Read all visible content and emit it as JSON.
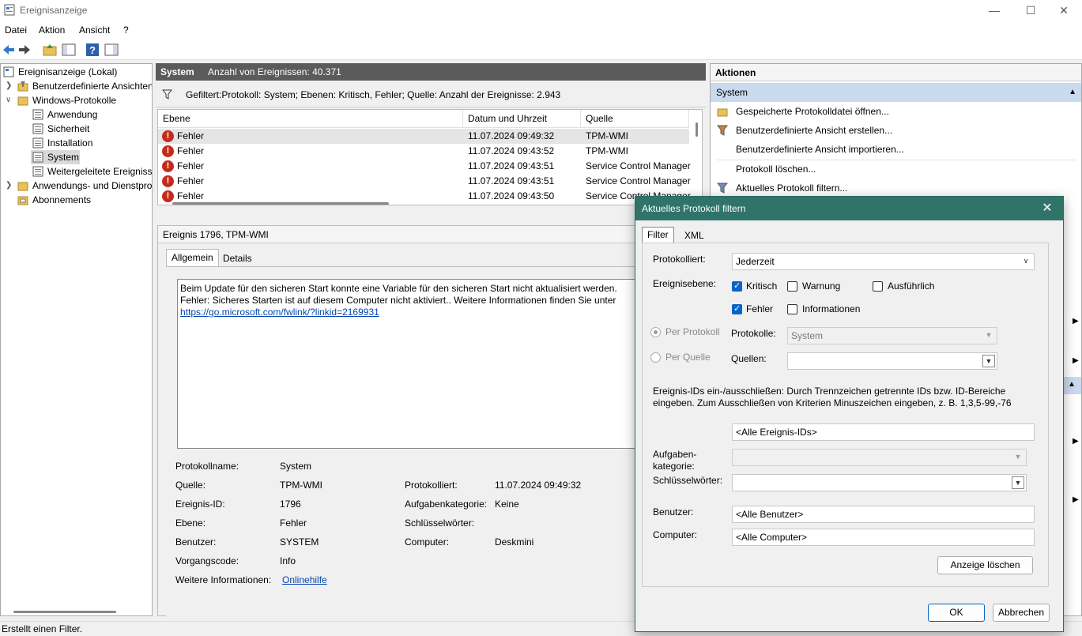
{
  "window": {
    "title": "Ereignisanzeige",
    "minimize": "—",
    "maximize": "☐",
    "close": "✕"
  },
  "menu": [
    "Datei",
    "Aktion",
    "Ansicht",
    "?"
  ],
  "tree": {
    "root": "Ereignisanzeige (Lokal)",
    "custom_views": "Benutzerdefinierte Ansichten",
    "windows_logs": "Windows-Protokolle",
    "logs": [
      "Anwendung",
      "Sicherheit",
      "Installation",
      "System",
      "Weitergeleitete Ereignisse"
    ],
    "app_service_logs": "Anwendungs- und Dienstprotokolle",
    "subscriptions": "Abonnements"
  },
  "center": {
    "header_title": "System",
    "header_count": "Anzahl von Ereignissen: 40.371",
    "filter_text": "Gefiltert:Protokoll: System; Ebenen: Kritisch, Fehler; Quelle:  Anzahl der Ereignisse: 2.943",
    "columns": [
      "Ebene",
      "Datum und Uhrzeit",
      "Quelle"
    ],
    "rows": [
      {
        "level": "Fehler",
        "date": "11.07.2024 09:49:32",
        "source": "TPM-WMI"
      },
      {
        "level": "Fehler",
        "date": "11.07.2024 09:43:52",
        "source": "TPM-WMI"
      },
      {
        "level": "Fehler",
        "date": "11.07.2024 09:43:51",
        "source": "Service Control Manager"
      },
      {
        "level": "Fehler",
        "date": "11.07.2024 09:43:51",
        "source": "Service Control Manager"
      },
      {
        "level": "Fehler",
        "date": "11.07.2024 09:43:50",
        "source": "Service Control Manager"
      }
    ]
  },
  "detail": {
    "title": "Ereignis 1796, TPM-WMI",
    "tabs": [
      "Allgemein",
      "Details"
    ],
    "description": "Beim Update für den sicheren Start konnte eine Variable für den sicheren Start nicht aktualisiert werden. Fehler: Sicheres Starten ist auf diesem Computer nicht aktiviert.. Weitere Informationen finden Sie unter",
    "link": "https://go.microsoft.com/fwlink/?linkid=2169931",
    "props": {
      "logname_label": "Protokollname:",
      "logname": "System",
      "source_label": "Quelle:",
      "source": "TPM-WMI",
      "logged_label": "Protokolliert:",
      "logged": "11.07.2024 09:49:32",
      "eventid_label": "Ereignis-ID:",
      "eventid": "1796",
      "taskcat_label": "Aufgabenkategorie:",
      "taskcat": "Keine",
      "level_label": "Ebene:",
      "level": "Fehler",
      "keywords_label": "Schlüsselwörter:",
      "user_label": "Benutzer:",
      "user": "SYSTEM",
      "computer_label": "Computer:",
      "computer": "Deskmini",
      "opcode_label": "Vorgangscode:",
      "opcode": "Info",
      "moreinfo_label": "Weitere Informationen:",
      "moreinfo": "Onlinehilfe"
    }
  },
  "actions": {
    "title": "Aktionen",
    "section": "System",
    "items": [
      "Gespeicherte Protokolldatei öffnen...",
      "Benutzerdefinierte Ansicht erstellen...",
      "Benutzerdefinierte Ansicht importieren...",
      "Protokoll löschen...",
      "Aktuelles Protokoll filtern..."
    ]
  },
  "dialog": {
    "title": "Aktuelles Protokoll filtern",
    "tabs": [
      "Filter",
      "XML"
    ],
    "logged_label": "Protokolliert:",
    "logged_value": "Jederzeit",
    "level_label": "Ereignisebene:",
    "levels": {
      "critical": "Kritisch",
      "warning": "Warnung",
      "verbose": "Ausführlich",
      "error": "Fehler",
      "info": "Informationen"
    },
    "by_log": "Per Protokoll",
    "by_source": "Per Quelle",
    "logs_label": "Protokolle:",
    "logs_value": "System",
    "sources_label": "Quellen:",
    "ids_hint": "Ereignis-IDs ein-/ausschließen: Durch Trennzeichen getrennte IDs bzw. ID-Bereiche eingeben. Zum Ausschließen von Kriterien Minuszeichen eingeben, z. B. 1,3,5-99,-76",
    "ids_value": "<Alle Ereignis-IDs>",
    "taskcat_label_1": "Aufgaben-",
    "taskcat_label_2": "kategorie:",
    "keywords_label": "Schlüsselwörter:",
    "user_label": "Benutzer:",
    "user_value": "<Alle Benutzer>",
    "computer_label": "Computer:",
    "computer_value": "<Alle Computer>",
    "clear_button": "Anzeige löschen",
    "ok_button": "OK",
    "cancel_button": "Abbrechen"
  },
  "status": "Erstellt einen Filter."
}
